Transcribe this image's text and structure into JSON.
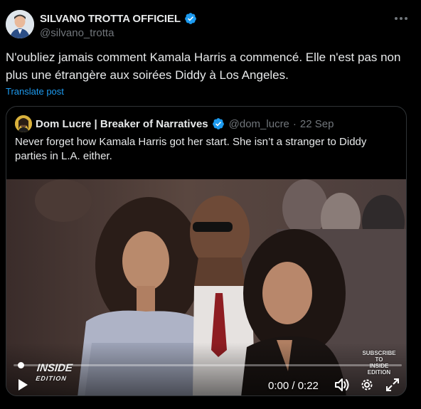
{
  "post": {
    "author_name": "SILVANO TROTTA OFFICIEL",
    "author_handle": "@silvano_trotta",
    "text": "N'oubliez jamais comment Kamala Harris a commencé. Elle n'est pas non plus une étrangère aux soirées Diddy à Los Angeles.",
    "translate_label": "Translate post",
    "verified": true
  },
  "quote": {
    "author_name": "Dom Lucre | Breaker of Narratives",
    "author_handle": "@dom_lucre",
    "separator": "·",
    "date": "22 Sep",
    "text": "Never forget how Kamala Harris got her start. She isn’t a stranger to Diddy parties in L.A. either.",
    "verified": true
  },
  "video": {
    "watermark_left_main": "INSIDE",
    "watermark_left_sub": "EDITION",
    "watermark_right_lines": [
      "SUBSCRIBE",
      "TO",
      "INSIDE",
      "EDITION"
    ],
    "time_display": "0:00 / 0:22",
    "progress_fraction": 0.0,
    "icons": [
      "play-icon",
      "volume-icon",
      "settings-icon",
      "fullscreen-icon"
    ]
  },
  "colors": {
    "background": "#000000",
    "text": "#e7e9ea",
    "muted": "#71767b",
    "accent": "#1d9bf0",
    "border": "#2f3336"
  }
}
